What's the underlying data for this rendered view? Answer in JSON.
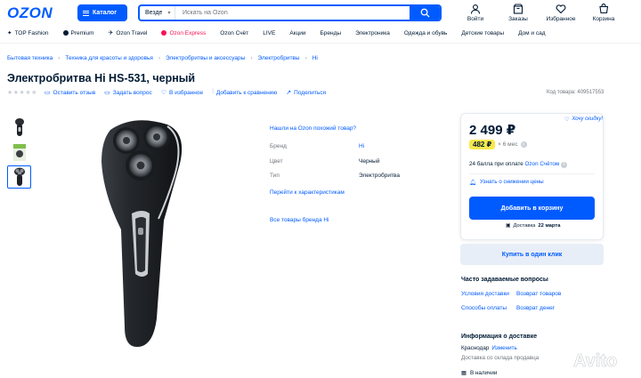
{
  "header": {
    "logo": "OZON",
    "catalog_label": "Каталог",
    "search_scope": "Везде",
    "search_placeholder": "Искать на Ozon",
    "icons": [
      {
        "label": "Войти",
        "icon": "user-icon"
      },
      {
        "label": "Заказы",
        "icon": "box-icon"
      },
      {
        "label": "Избранное",
        "icon": "heart-icon"
      },
      {
        "label": "Корзина",
        "icon": "cart-icon"
      }
    ]
  },
  "topnav": [
    {
      "label": "TOP Fashion",
      "icon": "star-icon",
      "color": "#001a34"
    },
    {
      "label": "Premium",
      "icon": "premium-icon",
      "color": "#001a34"
    },
    {
      "label": "Ozon Travel",
      "icon": "travel-icon",
      "color": "#001a34"
    },
    {
      "label": "Ozon Express",
      "icon": "express-icon",
      "color": "#f91155"
    },
    {
      "label": "Ozon Счёт",
      "icon": "",
      "color": "#001a34"
    },
    {
      "label": "LIVE",
      "icon": "",
      "color": "#001a34"
    },
    {
      "label": "Акции",
      "icon": "",
      "color": "#001a34"
    },
    {
      "label": "Бренды",
      "icon": "",
      "color": "#001a34"
    },
    {
      "label": "Электроника",
      "icon": "",
      "color": "#001a34"
    },
    {
      "label": "Одежда и обувь",
      "icon": "",
      "color": "#001a34"
    },
    {
      "label": "Детские товары",
      "icon": "",
      "color": "#001a34"
    },
    {
      "label": "Дом и сад",
      "icon": "",
      "color": "#001a34"
    }
  ],
  "breadcrumbs": [
    "Бытовая техника",
    "Техника для красоты и здоровья",
    "Электробритвы и аксессуары",
    "Электробритвы",
    "Hi"
  ],
  "product": {
    "title": "Электробритва Hi HS-531, черный",
    "code": "Код товара: 409517553",
    "actions": {
      "review": "Оставить отзыв",
      "ask": "Задать вопрос",
      "favorite": "В избранное",
      "compare": "Добавить к сравнению",
      "share": "Поделиться"
    }
  },
  "specs": {
    "cheaper_link": "Нашли на Ozon похожий товар?",
    "rows": [
      {
        "key": "Бренд",
        "value": "Hi"
      },
      {
        "key": "Цвет",
        "value": "Черный"
      },
      {
        "key": "Тип",
        "value": "Электробритва"
      }
    ],
    "more_link": "Перейти к характеристикам",
    "brand_link": "Все товары бренда Hi"
  },
  "buy": {
    "want_discount": "Хочу скидку!",
    "price": "2 499 ₽",
    "installment_price": "482 ₽",
    "installment_term": "× 6 мес",
    "bonus_prefix": "24 балла при оплате ",
    "bonus_link": "Ozon Счётом",
    "notify": "Узнать о снижении цены",
    "cart_button": "Добавить в корзину",
    "delivery_prefix": "Доставка ",
    "delivery_date": "22 марта",
    "one_click": "Купить в один клик",
    "accent": "#005bff",
    "installment_color": "#f9e84b"
  },
  "faq": {
    "title": "Часто задаваемые вопросы",
    "items": [
      "Условия доставки",
      "Возврат товаров",
      "Способы оплаты",
      "Возврат денег"
    ]
  },
  "delivery_info": {
    "title": "Информация о доставке",
    "city": "Краснодар",
    "change": "Изменить",
    "warehouse": "Доставка со склада продавца",
    "stock": "В наличии"
  },
  "watermark": "Avito"
}
